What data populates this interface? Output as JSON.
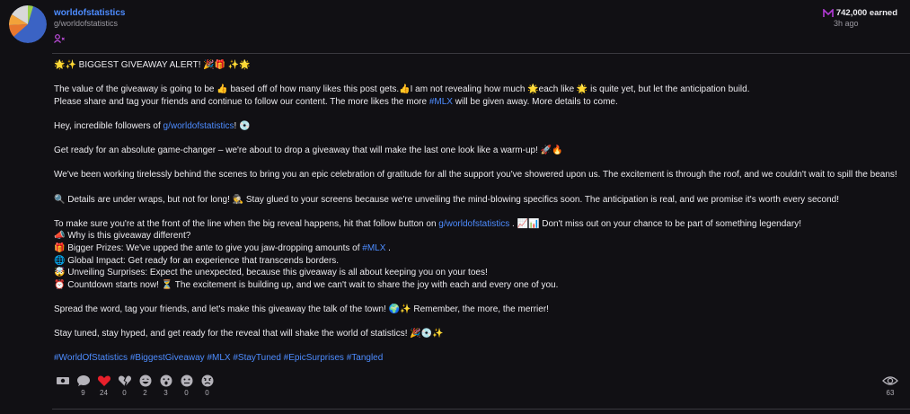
{
  "post": {
    "author": "worldofstatistics",
    "group": "g/worldofstatistics",
    "earned": "742,000 earned",
    "time": "3h ago",
    "avatar_icon": "pie-chart-avatar",
    "accent_color": "#4d8cff",
    "earned_icon_color": "#b23ad6"
  },
  "content": {
    "l1": "🌟✨ BIGGEST GIVEAWAY ALERT! 🎉🎁 ✨🌟",
    "l2": "The value of the giveaway is going to be 👍 based off of how many likes this post gets.👍I am not revealing how much 🌟each like 🌟 is quite yet, but let the anticipation build.",
    "l3a": "Please share and tag your friends and continue to follow our content. The more likes the more ",
    "l3_link": "#MLX",
    "l3b": " will be given away. More details to come.",
    "l4a": "Hey, incredible followers of ",
    "l4_link": "g/worldofstatistics",
    "l4b": "! 💿",
    "l5": "Get ready for an absolute game-changer – we're about to drop a giveaway that will make the last one look like a warm-up! 🚀🔥",
    "l6": "We've been working tirelessly behind the scenes to bring you an epic celebration of gratitude for all the support you've showered upon us. The excitement is through the roof, and we couldn't wait to spill the beans!",
    "l7": "🔍 Details are under wraps, but not for long! 🕵️ Stay glued to your screens because we're unveiling the mind-blowing specifics soon. The anticipation is real, and we promise it's worth every second!",
    "l8a": "To make sure you're at the front of the line when the big reveal happens, hit that follow button on ",
    "l8_link": "g/worldofstatistics",
    "l8b": " . 📈📊 Don't miss out on your chance to be part of something legendary!",
    "l9": "📣 Why is this giveaway different?",
    "l10a": "🎁 Bigger Prizes: We've upped the ante to give you jaw-dropping amounts of ",
    "l10_link": "#MLX",
    "l10b": " .",
    "l11": "🌐 Global Impact: Get ready for an experience that transcends borders.",
    "l12": "🤯 Unveiling Surprises: Expect the unexpected, because this giveaway is all about keeping you on your toes!",
    "l13": "⏰ Countdown starts now! ⏳ The excitement is building up, and we can't wait to share the joy with each and every one of you.",
    "l14": "Spread the word, tag your friends, and let's make this giveaway the talk of the town! 🌍✨ Remember, the more, the merrier!",
    "l15": "Stay tuned, stay hyped, and get ready for the reveal that will shake the world of statistics! 🎉💿✨",
    "hashtags": "#WorldOfStatistics #BiggestGiveaway #MLX #StayTuned #EpicSurprises #Tangled"
  },
  "reactions": [
    {
      "icon": "tip-money-icon",
      "count": ""
    },
    {
      "icon": "comment-icon",
      "count": "9"
    },
    {
      "icon": "heart-icon",
      "count": "24"
    },
    {
      "icon": "broken-heart-icon",
      "count": "0"
    },
    {
      "icon": "laugh-icon",
      "count": "2"
    },
    {
      "icon": "wow-icon",
      "count": "3"
    },
    {
      "icon": "neutral-icon",
      "count": "0"
    },
    {
      "icon": "angry-icon",
      "count": "0"
    }
  ],
  "views": {
    "icon": "eye-icon",
    "count": "63"
  },
  "colors": {
    "heart": "#e8202b",
    "icon": "#b5b3ba"
  }
}
